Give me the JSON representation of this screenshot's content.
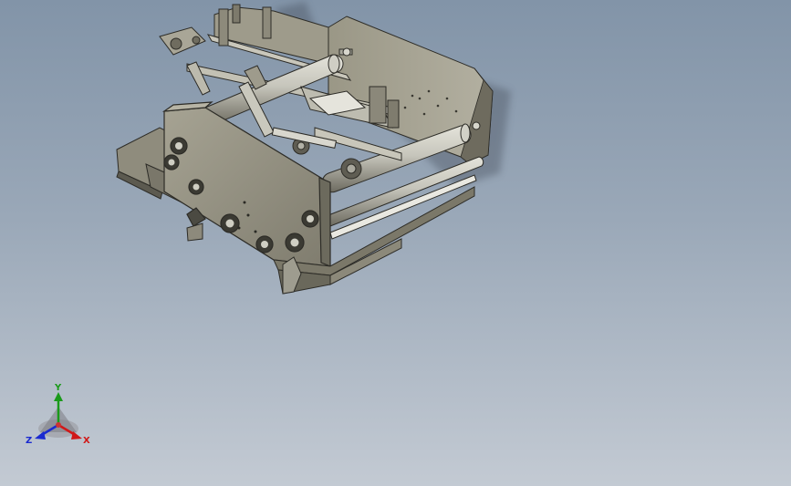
{
  "viewport": {
    "background_top": "#8294a8",
    "background_bottom": "#c3cad3"
  },
  "model": {
    "icon": "machine-assembly",
    "body_color": "#8a8778",
    "roller_color": "#b9b8ad"
  },
  "triad": {
    "x_label": "X",
    "y_label": "Y",
    "z_label": "Z",
    "x_color": "#d01818",
    "y_color": "#1a9a1a",
    "z_color": "#1a2ad0"
  }
}
